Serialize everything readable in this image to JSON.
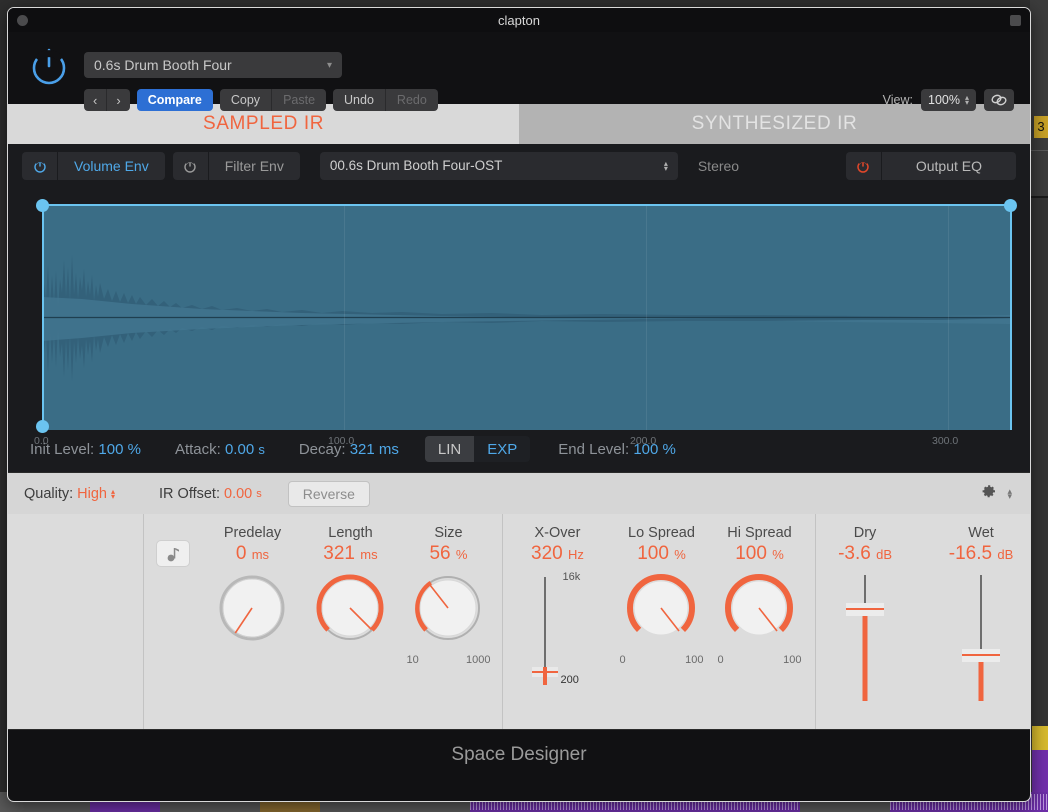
{
  "window": {
    "title": "clapton",
    "footer_title": "Space Designer"
  },
  "toolbar": {
    "power_icon": "power-icon",
    "preset_name": "0.6s Drum Booth Four",
    "prev_label": "‹",
    "next_label": "›",
    "compare_label": "Compare",
    "copy_label": "Copy",
    "paste_label": "Paste",
    "undo_label": "Undo",
    "redo_label": "Redo",
    "view_label": "View:",
    "view_value": "100%",
    "link_icon": "link-icon",
    "accent_blue": "#2d6fd4"
  },
  "ir_tabs": {
    "sampled_label": "SAMPLED IR",
    "synthesized_label": "SYNTHESIZED IR",
    "active": "SAMPLED IR",
    "active_color": "#f0653f"
  },
  "env_bar": {
    "volume_env_label": "Volume Env",
    "filter_env_label": "Filter Env",
    "ir_file": "00.6s Drum Booth Four-OST",
    "stereo_label": "Stereo",
    "output_eq_label": "Output EQ",
    "volume_power_icon": "power-icon",
    "filter_power_icon": "power-icon",
    "output_eq_power_icon": "power-icon"
  },
  "envelope": {
    "axis_ticks": [
      "0.0",
      "100.0",
      "200.0",
      "300.0"
    ],
    "init_level_label": "Init Level:",
    "init_level_value": "100 %",
    "attack_label": "Attack:",
    "attack_value": "0.00",
    "attack_unit": "s",
    "decay_label": "Decay:",
    "decay_value": "321 ms",
    "lin_label": "LIN",
    "exp_label": "EXP",
    "curve_mode": "EXP",
    "end_level_label": "End Level:",
    "end_level_value": "100 %",
    "handle_color": "#6bc4f0",
    "waveform_color": "#3c6e86"
  },
  "quality_bar": {
    "quality_label": "Quality:",
    "quality_value": "High",
    "ir_offset_label": "IR Offset:",
    "ir_offset_value": "0.00",
    "ir_offset_unit": "s",
    "reverse_label": "Reverse",
    "gear_icon": "gear-icon",
    "stepper_icon": "stepper-icon"
  },
  "controls": {
    "note_icon": "music-note-icon",
    "knobs": [
      {
        "name": "Predelay",
        "value": "0",
        "unit": "ms",
        "angle": -165,
        "arc": 0,
        "range_min": "",
        "range_max": ""
      },
      {
        "name": "Length",
        "value": "321",
        "unit": "ms",
        "angle": 50,
        "arc": 205,
        "range_min": "",
        "range_max": ""
      },
      {
        "name": "Size",
        "value": "56",
        "unit": "%",
        "angle": -40,
        "arc": 95,
        "range_min": "10",
        "range_max": "1000"
      },
      {
        "name": "Lo Spread",
        "value": "100",
        "unit": "%",
        "angle": 40,
        "arc": 290,
        "range_min": "0",
        "range_max": "100"
      },
      {
        "name": "Hi Spread",
        "value": "100",
        "unit": "%",
        "angle": 40,
        "arc": 290,
        "range_min": "0",
        "range_max": "100"
      }
    ],
    "xover": {
      "name": "X-Over",
      "value": "320",
      "unit": "Hz",
      "top_label": "16k",
      "bottom_label": "200",
      "position_pct": 94
    },
    "faders": [
      {
        "name": "Dry",
        "value": "-3.6",
        "unit": "dB",
        "position_pct": 30
      },
      {
        "name": "Wet",
        "value": "-16.5",
        "unit": "dB",
        "position_pct": 63
      }
    ]
  },
  "colors": {
    "orange": "#f0653f",
    "blue": "#4fa8e8",
    "panel_light": "#dcdcdc",
    "panel_dark": "#1a1b1e"
  }
}
